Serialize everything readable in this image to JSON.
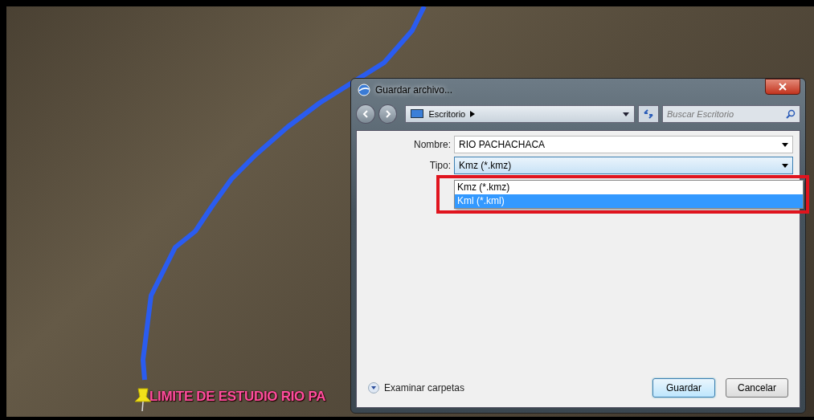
{
  "map": {
    "placemark_label": "LIMITE DE ESTUDIO RIO PA"
  },
  "dialog": {
    "title": "Guardar archivo...",
    "location": "Escritorio",
    "search": {
      "placeholder": "Buscar Escritorio"
    },
    "fields": [
      {
        "label": "Nombre:",
        "value": "RIO PACHACHACA",
        "focused": false
      },
      {
        "label": "Tipo:",
        "value": "Kmz (*.kmz)",
        "focused": true
      }
    ],
    "type_options": [
      {
        "label": "Kmz (*.kmz)",
        "selected": false
      },
      {
        "label": "Kml (*.kml)",
        "selected": true
      }
    ],
    "browse_folders": "Examinar carpetas",
    "buttons": [
      {
        "label": "Guardar",
        "kind": "default"
      },
      {
        "label": "Cancelar",
        "kind": "normal"
      }
    ]
  }
}
